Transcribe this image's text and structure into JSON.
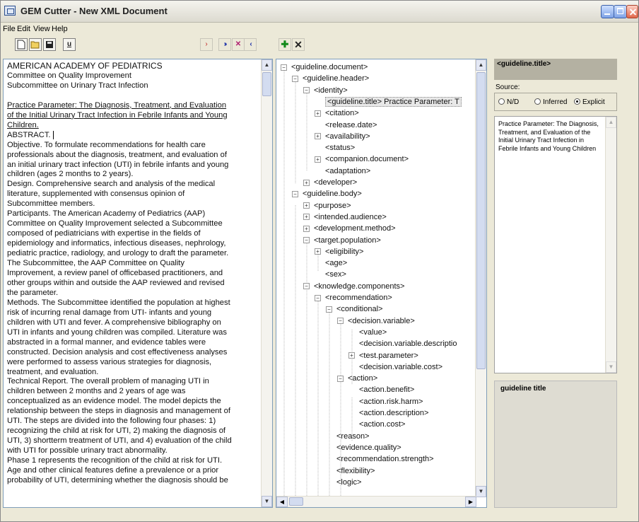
{
  "window": {
    "title": "GEM Cutter - New XML Document"
  },
  "menu": [
    "File",
    "Edit",
    "View",
    "Help"
  ],
  "toolbar": {
    "new_icon": "new-document-icon",
    "open_icon": "open-folder-icon",
    "save_icon": "save-disk-icon",
    "u_label": "u",
    "left_buttons": [
      "step",
      "forward",
      "cut",
      "back"
    ],
    "add_icon": "add-icon",
    "delete_icon": "delete-x-icon"
  },
  "document": {
    "header_lines": [
      "AMERICAN ACADEMY OF PEDIATRICS",
      "Committee on Quality Improvement",
      "Subcommittee on Urinary Tract Infection"
    ],
    "title_lines": [
      "Practice Parameter: The Diagnosis, Treatment, and Evaluation",
      "of the Initial Urinary Tract Infection in Febrile Infants and Young",
      "Children."
    ],
    "abstract_label": "ABSTRACT.",
    "body_lines": [
      "Objective. To formulate recommendations for health care",
      "professionals about the diagnosis, treatment, and evaluation of",
      "an initial urinary tract infection (UTI) in febrile infants and young",
      "children (ages 2 months to 2 years).",
      "Design. Comprehensive search and analysis of the medical",
      "literature, supplemented with consensus opinion of",
      "Subcommittee members.",
      "Participants. The American Academy of Pediatrics (AAP)",
      "Committee on Quality Improvement selected a Subcommittee",
      "composed of pediatricians with expertise in the fields of",
      "epidemiology and informatics, infectious diseases, nephrology,",
      "pediatric practice, radiology, and urology to draft the parameter.",
      "The Subcommittee, the AAP Committee on Quality",
      "Improvement, a review panel of officebased practitioners, and",
      "other groups within and outside the AAP reviewed and revised",
      "the parameter.",
      "Methods. The Subcommittee identified the population at highest",
      "risk of incurring renal damage from UTI- infants and young",
      "children with UTI and fever. A comprehensive bibliography on",
      "UTI in infants and young children was compiled. Literature was",
      "abstracted in a formal manner, and evidence tables were",
      "constructed. Decision analysis and cost effectiveness analyses",
      "were performed to assess various strategies for diagnosis,",
      "treatment, and evaluation.",
      "Technical Report. The overall problem of managing UTI in",
      "children between 2 months and 2 years of age was",
      "conceptualized as an evidence model. The model depicts the",
      "relationship between the steps in diagnosis and management of",
      "UTI. The steps are divided into the following four phases: 1)",
      "recognizing the child at risk for UTI, 2) making the diagnosis of",
      "UTI, 3) shortterm treatment of UTI, and 4) evaluation of the child",
      "with UTI for possible urinary tract abnormality.",
      "Phase 1 represents the recognition of the child at risk for UTI.",
      "Age and other clinical features define a prevalence or a prior",
      "probability of UTI, determining whether the diagnosis should be"
    ]
  },
  "tree": [
    {
      "label": "<guideline.document>",
      "exp": "−"
    },
    {
      "label": "<guideline.header>",
      "exp": "−"
    },
    {
      "label": "<identity>",
      "exp": "−"
    },
    {
      "label": "<guideline.title> Practice Parameter: T",
      "exp": "",
      "selected": true
    },
    {
      "label": "<citation>",
      "exp": "+"
    },
    {
      "label": "<release.date>",
      "exp": ""
    },
    {
      "label": "<availability>",
      "exp": "+"
    },
    {
      "label": "<status>",
      "exp": ""
    },
    {
      "label": "<companion.document>",
      "exp": "+"
    },
    {
      "label": "<adaptation>",
      "exp": ""
    },
    {
      "label": "<developer>",
      "exp": "+"
    },
    {
      "label": "<guideline.body>",
      "exp": "−"
    },
    {
      "label": "<purpose>",
      "exp": "+"
    },
    {
      "label": "<intended.audience>",
      "exp": "+"
    },
    {
      "label": "<development.method>",
      "exp": "+"
    },
    {
      "label": "<target.population>",
      "exp": "−"
    },
    {
      "label": "<eligibility>",
      "exp": "+"
    },
    {
      "label": "<age>",
      "exp": ""
    },
    {
      "label": "<sex>",
      "exp": ""
    },
    {
      "label": "<knowledge.components>",
      "exp": "−"
    },
    {
      "label": "<recommendation>",
      "exp": "−"
    },
    {
      "label": "<conditional>",
      "exp": "−"
    },
    {
      "label": "<decision.variable>",
      "exp": "−"
    },
    {
      "label": "<value>",
      "exp": ""
    },
    {
      "label": "<decision.variable.descriptio",
      "exp": ""
    },
    {
      "label": "<test.parameter>",
      "exp": "+"
    },
    {
      "label": "<decision.variable.cost>",
      "exp": ""
    },
    {
      "label": "<action>",
      "exp": "−"
    },
    {
      "label": "<action.benefit>",
      "exp": ""
    },
    {
      "label": "<action.risk.harm>",
      "exp": ""
    },
    {
      "label": "<action.description>",
      "exp": ""
    },
    {
      "label": "<action.cost>",
      "exp": ""
    },
    {
      "label": "<reason>",
      "exp": ""
    },
    {
      "label": "<evidence.quality>",
      "exp": ""
    },
    {
      "label": "<recommendation.strength>",
      "exp": ""
    },
    {
      "label": "<flexibility>",
      "exp": ""
    },
    {
      "label": "<logic>",
      "exp": ""
    }
  ],
  "right": {
    "element_name": "<guideline.title>",
    "source_label": "Source:",
    "source_options": [
      {
        "label": "N/D",
        "checked": false
      },
      {
        "label": "Inferred",
        "checked": false
      },
      {
        "label": "Explicit",
        "checked": true
      }
    ],
    "value_text": "Practice Parameter: The Diagnosis, Treatment, and Evaluation of the Initial Urinary Tract Infection in Febrile Infants and Young Children",
    "description": "guideline title"
  }
}
